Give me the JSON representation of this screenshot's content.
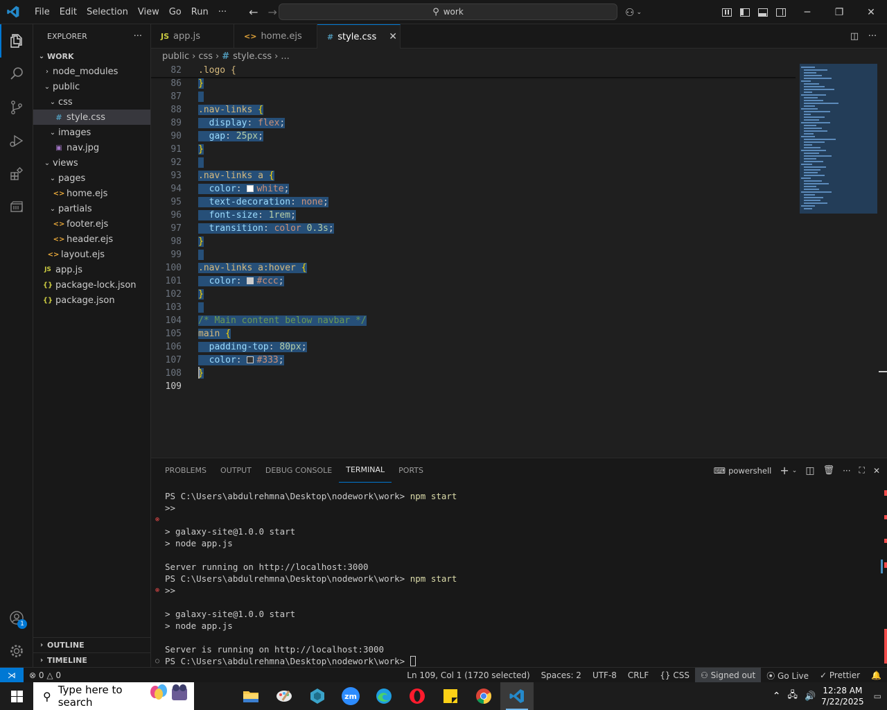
{
  "menu": [
    "File",
    "Edit",
    "Selection",
    "View",
    "Go",
    "Run",
    "···"
  ],
  "command_center": {
    "text": "work"
  },
  "sidebar": {
    "title": "EXPLORER",
    "more": "···",
    "root": "WORK",
    "tree": [
      {
        "label": "node_modules",
        "type": "folder",
        "expanded": false,
        "depth": 1
      },
      {
        "label": "public",
        "type": "folder",
        "expanded": true,
        "depth": 1
      },
      {
        "label": "css",
        "type": "folder",
        "expanded": true,
        "depth": 2
      },
      {
        "label": "style.css",
        "type": "css",
        "depth": 3,
        "selected": true
      },
      {
        "label": "images",
        "type": "folder",
        "expanded": true,
        "depth": 2
      },
      {
        "label": "nav.jpg",
        "type": "img",
        "depth": 3
      },
      {
        "label": "views",
        "type": "folder",
        "expanded": true,
        "depth": 1
      },
      {
        "label": "pages",
        "type": "folder",
        "expanded": true,
        "depth": 2
      },
      {
        "label": "home.ejs",
        "type": "ejs",
        "depth": 3
      },
      {
        "label": "partials",
        "type": "folder",
        "expanded": true,
        "depth": 2
      },
      {
        "label": "footer.ejs",
        "type": "ejs",
        "depth": 3
      },
      {
        "label": "header.ejs",
        "type": "ejs",
        "depth": 3
      },
      {
        "label": "layout.ejs",
        "type": "ejs",
        "depth": 2
      },
      {
        "label": "app.js",
        "type": "js",
        "depth": 1
      },
      {
        "label": "package-lock.json",
        "type": "json",
        "depth": 1
      },
      {
        "label": "package.json",
        "type": "json",
        "depth": 1
      }
    ],
    "outline": "OUTLINE",
    "timeline": "TIMELINE"
  },
  "icons": {
    "js": "JS",
    "ejs": "<>",
    "json": "{}",
    "css": "#",
    "img": "▣"
  },
  "tabs": [
    {
      "label": "app.js",
      "icon": "JS"
    },
    {
      "label": "home.ejs",
      "icon": "<>"
    },
    {
      "label": "style.css",
      "icon": "#",
      "active": true
    }
  ],
  "breadcrumb": [
    "public",
    "css",
    "style.css",
    "..."
  ],
  "editor": {
    "sticky": {
      "ln": "82",
      "text": ".logo {"
    },
    "lines": [
      {
        "ln": "86",
        "parts": [
          [
            "}",
            "brace"
          ]
        ]
      },
      {
        "ln": "87",
        "parts": []
      },
      {
        "ln": "88",
        "parts": [
          [
            ".nav-links",
            "sel"
          ],
          [
            " ",
            "punc"
          ],
          [
            "{",
            "brace"
          ]
        ]
      },
      {
        "ln": "89",
        "parts": [
          [
            "  ",
            "punc"
          ],
          [
            "display",
            "prop"
          ],
          [
            ": ",
            "punc"
          ],
          [
            "flex",
            "val"
          ],
          [
            ";",
            "punc"
          ]
        ]
      },
      {
        "ln": "90",
        "parts": [
          [
            "  ",
            "punc"
          ],
          [
            "gap",
            "prop"
          ],
          [
            ": ",
            "punc"
          ],
          [
            "25px",
            "num"
          ],
          [
            ";",
            "punc"
          ]
        ]
      },
      {
        "ln": "91",
        "parts": [
          [
            "}",
            "brace"
          ]
        ]
      },
      {
        "ln": "92",
        "parts": []
      },
      {
        "ln": "93",
        "parts": [
          [
            ".nav-links a",
            "sel"
          ],
          [
            " ",
            "punc"
          ],
          [
            "{",
            "brace"
          ]
        ]
      },
      {
        "ln": "94",
        "parts": [
          [
            "  ",
            "punc"
          ],
          [
            "color",
            "prop"
          ],
          [
            ": ",
            "punc"
          ],
          [
            "#ffffff",
            "swatch"
          ],
          [
            "white",
            "val"
          ],
          [
            ";",
            "punc"
          ]
        ]
      },
      {
        "ln": "95",
        "parts": [
          [
            "  ",
            "punc"
          ],
          [
            "text-decoration",
            "prop"
          ],
          [
            ": ",
            "punc"
          ],
          [
            "none",
            "val"
          ],
          [
            ";",
            "punc"
          ]
        ]
      },
      {
        "ln": "96",
        "parts": [
          [
            "  ",
            "punc"
          ],
          [
            "font-size",
            "prop"
          ],
          [
            ": ",
            "punc"
          ],
          [
            "1rem",
            "num"
          ],
          [
            ";",
            "punc"
          ]
        ]
      },
      {
        "ln": "97",
        "parts": [
          [
            "  ",
            "punc"
          ],
          [
            "transition",
            "prop"
          ],
          [
            ": ",
            "punc"
          ],
          [
            "color ",
            "val"
          ],
          [
            "0.3s",
            "num"
          ],
          [
            ";",
            "punc"
          ]
        ]
      },
      {
        "ln": "98",
        "parts": [
          [
            "}",
            "brace"
          ]
        ]
      },
      {
        "ln": "99",
        "parts": []
      },
      {
        "ln": "100",
        "parts": [
          [
            ".nav-links a:hover",
            "sel"
          ],
          [
            " ",
            "punc"
          ],
          [
            "{",
            "brace"
          ]
        ]
      },
      {
        "ln": "101",
        "parts": [
          [
            "  ",
            "punc"
          ],
          [
            "color",
            "prop"
          ],
          [
            ": ",
            "punc"
          ],
          [
            "#cccccc",
            "swatch"
          ],
          [
            "#ccc",
            "val"
          ],
          [
            ";",
            "punc"
          ]
        ]
      },
      {
        "ln": "102",
        "parts": [
          [
            "}",
            "brace"
          ]
        ]
      },
      {
        "ln": "103",
        "parts": []
      },
      {
        "ln": "104",
        "parts": [
          [
            "/* Main content below navbar */",
            "cmt"
          ]
        ]
      },
      {
        "ln": "105",
        "parts": [
          [
            "main",
            "sel"
          ],
          [
            " ",
            "punc"
          ],
          [
            "{",
            "brace"
          ]
        ]
      },
      {
        "ln": "106",
        "parts": [
          [
            "  ",
            "punc"
          ],
          [
            "padding-top",
            "prop"
          ],
          [
            ": ",
            "punc"
          ],
          [
            "80px",
            "num"
          ],
          [
            ";",
            "punc"
          ]
        ]
      },
      {
        "ln": "107",
        "parts": [
          [
            "  ",
            "punc"
          ],
          [
            "color",
            "prop"
          ],
          [
            ": ",
            "punc"
          ],
          [
            "#333333",
            "swatch"
          ],
          [
            "#333",
            "val"
          ],
          [
            ";",
            "punc"
          ]
        ]
      },
      {
        "ln": "108",
        "parts": [
          [
            "}",
            "brace"
          ]
        ]
      },
      {
        "ln": "109",
        "parts": [],
        "current": true
      }
    ]
  },
  "panel": {
    "tabs": [
      "PROBLEMS",
      "OUTPUT",
      "DEBUG CONSOLE",
      "TERMINAL",
      "PORTS"
    ],
    "active_tab": "TERMINAL",
    "shell": "powershell",
    "terminal_lines": [
      {
        "text": "PS C:\\Users\\abdulrehmna\\Desktop\\nodework\\work> ",
        "cmd": "npm start"
      },
      {
        "text": ">>",
        "cmd": ""
      },
      {
        "text": "",
        "cmd": "",
        "marker": "error"
      },
      {
        "text": "> galaxy-site@1.0.0 start",
        "cmd": ""
      },
      {
        "text": "> node app.js",
        "cmd": ""
      },
      {
        "text": "",
        "cmd": ""
      },
      {
        "text": "Server running on http://localhost:3000",
        "cmd": ""
      },
      {
        "text": "PS C:\\Users\\abdulrehmna\\Desktop\\nodework\\work> ",
        "cmd": "npm start"
      },
      {
        "text": ">>",
        "cmd": "",
        "marker": "error"
      },
      {
        "text": "",
        "cmd": ""
      },
      {
        "text": "> galaxy-site@1.0.0 start",
        "cmd": ""
      },
      {
        "text": "> node app.js",
        "cmd": ""
      },
      {
        "text": "",
        "cmd": ""
      },
      {
        "text": "Server is running on http://localhost:3000",
        "cmd": ""
      },
      {
        "text": "PS C:\\Users\\abdulrehmna\\Desktop\\nodework\\work> ",
        "cmd": "",
        "marker": "ok",
        "cursor": true
      }
    ]
  },
  "statusbar": {
    "errors": "0",
    "warnings": "0",
    "position": "Ln 109, Col 1 (1720 selected)",
    "spaces": "Spaces: 2",
    "encoding": "UTF-8",
    "eol": "CRLF",
    "language": "CSS",
    "account": "Signed out",
    "golive": "Go Live",
    "prettier": "Prettier"
  },
  "taskbar": {
    "search_placeholder": "Type here to search",
    "time": "12:28 AM",
    "date": "7/22/2025"
  },
  "colors": {
    "accent": "#0078d4",
    "selection": "#264f78",
    "error": "#f14c4c"
  }
}
